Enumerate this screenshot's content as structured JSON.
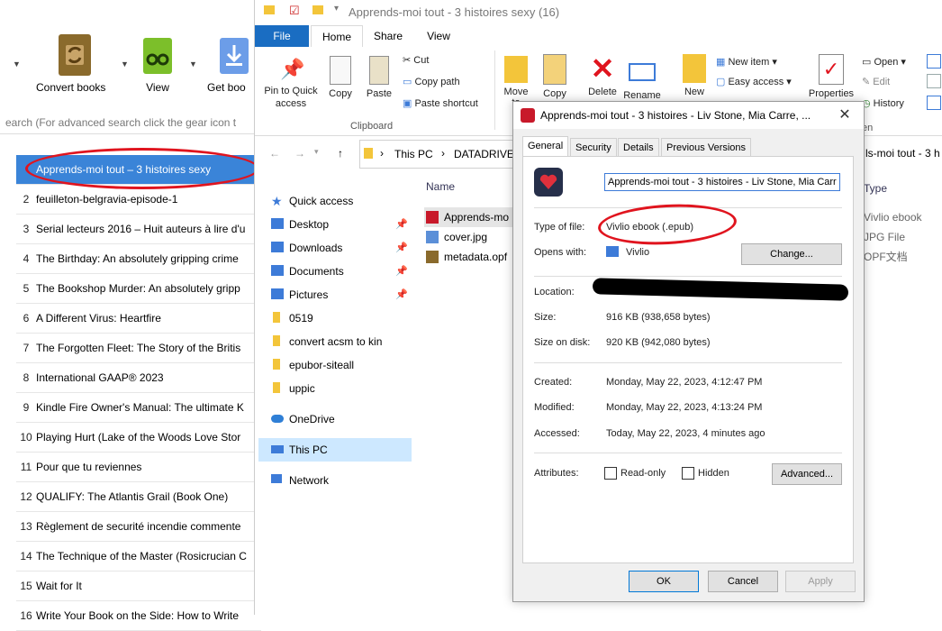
{
  "calibre": {
    "toolbar": [
      {
        "label": "Convert books",
        "icon": "convert-icon",
        "color": "#8a6a2c"
      },
      {
        "label": "View",
        "icon": "glasses-icon",
        "color": "#7cbf2a"
      },
      {
        "label": "Get boo",
        "icon": "download-icon",
        "color": "#3d7bd8"
      }
    ],
    "search_placeholder": "earch (For advanced search click the gear icon t",
    "books": [
      {
        "num": "",
        "title": "Apprends-moi tout – 3 histoires sexy"
      },
      {
        "num": "2",
        "title": "feuilleton-belgravia-episode-1"
      },
      {
        "num": "3",
        "title": "Serial lecteurs 2016 – Huit auteurs à lire d'u"
      },
      {
        "num": "4",
        "title": "The Birthday: An absolutely gripping crime"
      },
      {
        "num": "5",
        "title": "The Bookshop Murder: An absolutely gripp"
      },
      {
        "num": "6",
        "title": "A Different Virus: Heartfire"
      },
      {
        "num": "7",
        "title": "The Forgotten Fleet: The Story of the Britis"
      },
      {
        "num": "8",
        "title": "International GAAP® 2023"
      },
      {
        "num": "9",
        "title": "Kindle Fire Owner's Manual: The ultimate K"
      },
      {
        "num": "10",
        "title": "Playing Hurt (Lake of the Woods Love Stor"
      },
      {
        "num": "11",
        "title": "Pour que tu reviennes"
      },
      {
        "num": "12",
        "title": "QUALIFY: The Atlantis Grail (Book One)"
      },
      {
        "num": "13",
        "title": "Règlement de securité incendie commente"
      },
      {
        "num": "14",
        "title": "The Technique of the Master (Rosicrucian C"
      },
      {
        "num": "15",
        "title": "Wait for It"
      },
      {
        "num": "16",
        "title": "Write Your Book on the Side: How to Write"
      }
    ]
  },
  "explorer": {
    "title": "Apprends-moi tout - 3 histoires sexy (16)",
    "tabs": {
      "file": "File",
      "home": "Home",
      "share": "Share",
      "view": "View"
    },
    "ribbon": {
      "pin": "Pin to Quick access",
      "copy": "Copy",
      "paste": "Paste",
      "cut": "Cut",
      "copy_path": "Copy path",
      "paste_shortcut": "Paste shortcut",
      "clipboard_group": "Clipboard",
      "move": "Move",
      "move_sub": "to",
      "copy_to": "Copy",
      "delete": "Delete",
      "rename": "Rename",
      "new": "New",
      "new_item": "New item ▾",
      "easy_access": "Easy access ▾",
      "properties": "Properties",
      "open": "Open ▾",
      "edit": "Edit",
      "history": "History",
      "open_group_fragment": "en"
    },
    "address": {
      "root": "This PC",
      "drive": "DATADRIVE",
      "right_fragment": "ls-moi tout - 3 h"
    },
    "nav": {
      "quick_access": "Quick access",
      "items": [
        {
          "label": "Desktop",
          "icon": "desktop-icon",
          "pinned": true
        },
        {
          "label": "Downloads",
          "icon": "downloads-icon",
          "pinned": true
        },
        {
          "label": "Documents",
          "icon": "documents-icon",
          "pinned": true
        },
        {
          "label": "Pictures",
          "icon": "pictures-icon",
          "pinned": true
        },
        {
          "label": "0519",
          "icon": "folder-icon",
          "pinned": false
        },
        {
          "label": "convert acsm to kin",
          "icon": "folder-icon",
          "pinned": false
        },
        {
          "label": "epubor-siteall",
          "icon": "folder-icon",
          "pinned": false
        },
        {
          "label": "uppic",
          "icon": "folder-icon",
          "pinned": false
        }
      ],
      "onedrive": "OneDrive",
      "this_pc": "This PC",
      "network": "Network"
    },
    "columns": {
      "name": "Name",
      "type": "Type"
    },
    "files": [
      {
        "name": "Apprends-mo",
        "type": "Vivlio ebook",
        "icon": "vivlio-icon"
      },
      {
        "name": "cover.jpg",
        "type": "JPG File",
        "icon": "image-file-icon"
      },
      {
        "name": "metadata.opf",
        "type": "OPF文档",
        "icon": "opf-file-icon"
      }
    ]
  },
  "dialog": {
    "title": "Apprends-moi tout - 3 histoires - Liv Stone, Mia Carre, ...",
    "tabs": [
      "General",
      "Security",
      "Details",
      "Previous Versions"
    ],
    "filename": "Apprends-moi tout - 3 histoires - Liv Stone, Mia Carr",
    "type_label": "Type of file:",
    "type_value": "Vivlio ebook (.epub)",
    "opens_label": "Opens with:",
    "opens_value": "Vivlio",
    "change_button": "Change...",
    "location_label": "Location:",
    "size_label": "Size:",
    "size_value": "916 KB (938,658 bytes)",
    "size_disk_label": "Size on disk:",
    "size_disk_value": "920 KB (942,080 bytes)",
    "created_label": "Created:",
    "created_value": "Monday, May 22, 2023, 4:12:47 PM",
    "modified_label": "Modified:",
    "modified_value": "Monday, May 22, 2023, 4:13:24 PM",
    "accessed_label": "Accessed:",
    "accessed_value": "Today, May 22, 2023, 4 minutes ago",
    "attributes_label": "Attributes:",
    "readonly_label": "Read-only",
    "hidden_label": "Hidden",
    "advanced_button": "Advanced...",
    "ok": "OK",
    "cancel": "Cancel",
    "apply": "Apply"
  },
  "colors": {
    "accent_blue": "#3a84d8",
    "annotation_red": "#e0141e",
    "vivlio_red": "#d8202c"
  }
}
